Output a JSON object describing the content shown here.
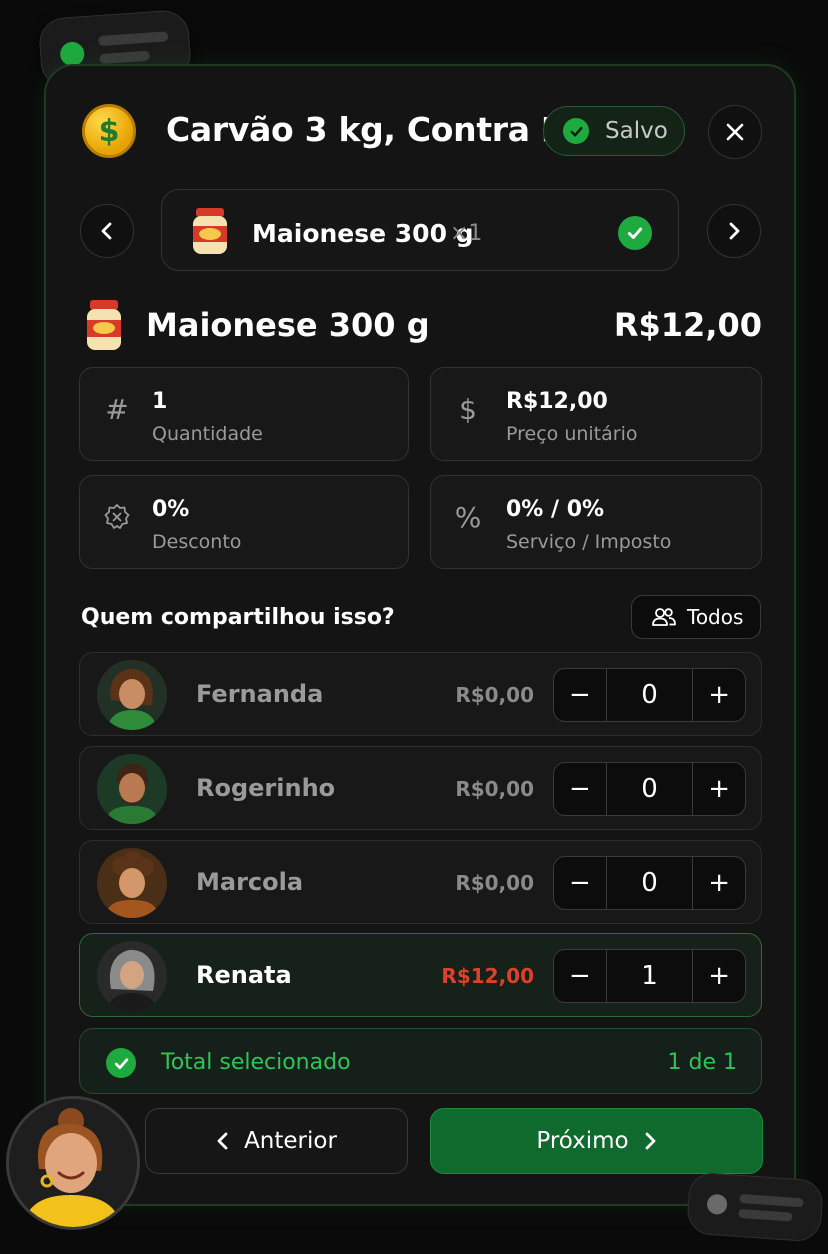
{
  "header": {
    "title": "Carvão 3 kg, Contra Fi...",
    "saved_label": "Salvo",
    "coin_symbol": "$"
  },
  "item_nav": {
    "name": "Maionese 300 g",
    "qty": "×1"
  },
  "product": {
    "name": "Maionese 300 g",
    "price": "R$12,00"
  },
  "details": [
    {
      "icon": "hash-icon",
      "glyph": "#",
      "value": "1",
      "caption": "Quantidade"
    },
    {
      "icon": "dollar-icon",
      "glyph": "$",
      "value": "R$12,00",
      "caption": "Preço unitário"
    },
    {
      "icon": "discount-badge-icon",
      "glyph": "",
      "value": "0%",
      "caption": "Desconto"
    },
    {
      "icon": "percent-icon",
      "glyph": "%",
      "value": "0% / 0%",
      "caption": "Serviço / Imposto"
    }
  ],
  "share": {
    "question": "Quem compartilhou isso?",
    "all_label": "Todos"
  },
  "people": [
    {
      "name": "Fernanda",
      "amount": "R$0,00",
      "count": "0",
      "selected": false
    },
    {
      "name": "Rogerinho",
      "amount": "R$0,00",
      "count": "0",
      "selected": false
    },
    {
      "name": "Marcola",
      "amount": "R$0,00",
      "count": "0",
      "selected": false
    },
    {
      "name": "Renata",
      "amount": "R$12,00",
      "count": "1",
      "selected": true
    }
  ],
  "stepper": {
    "minus": "−",
    "plus": "+"
  },
  "total": {
    "label": "Total selecionado",
    "count": "1 de 1"
  },
  "footer": {
    "prev_label": "Anterior",
    "next_label": "Próximo"
  },
  "colors": {
    "accent_green": "#1faa3f",
    "next_button": "#0f6a2e",
    "selected_amount": "#e0402a"
  }
}
